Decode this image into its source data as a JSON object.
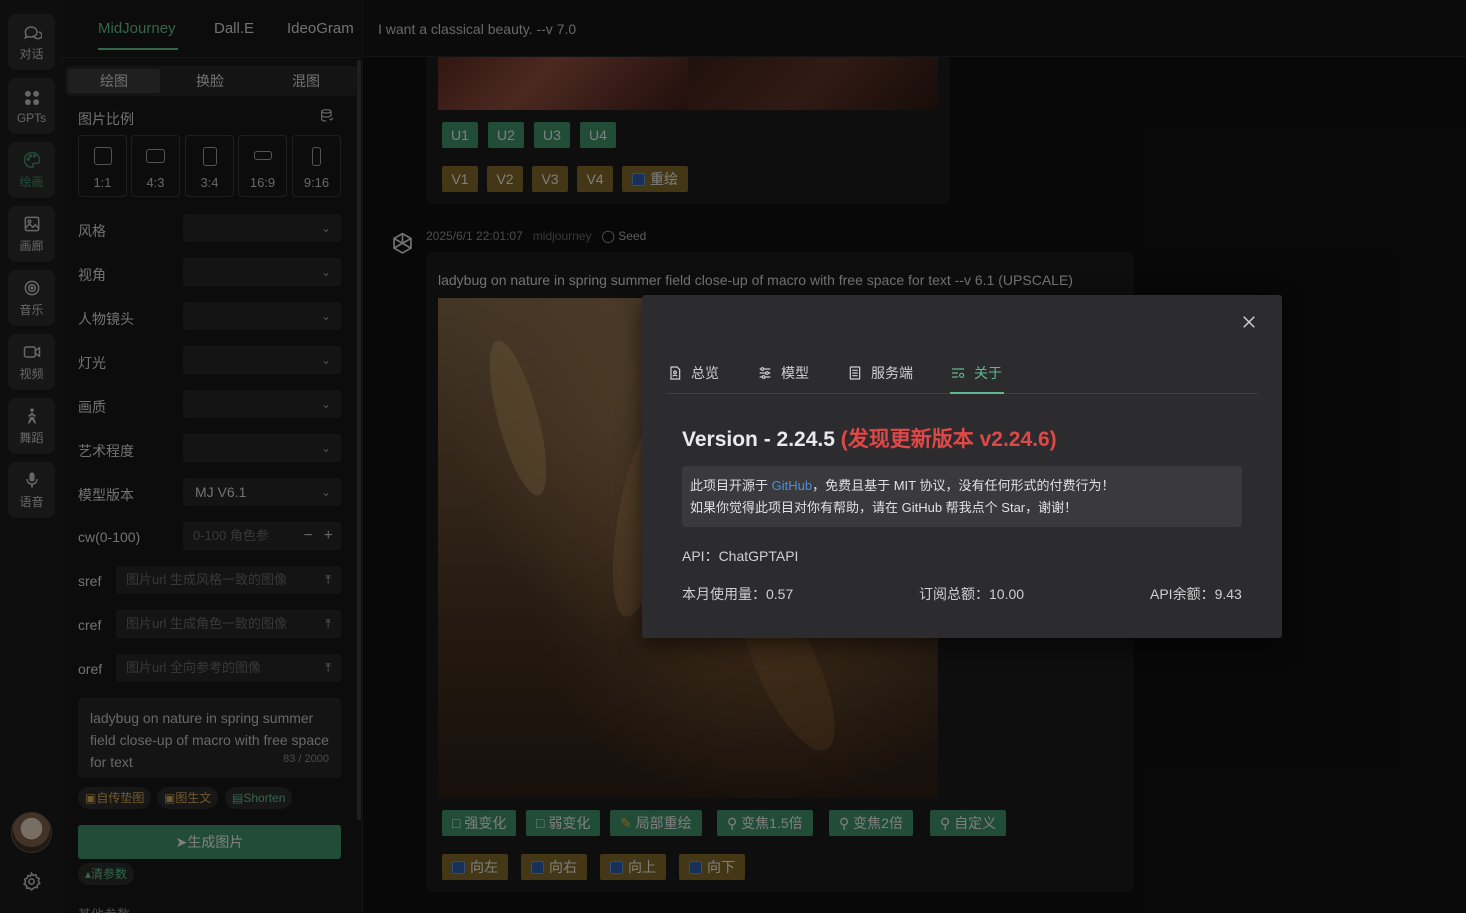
{
  "rail": {
    "items": [
      {
        "label": "对话",
        "icon": "chat-icon"
      },
      {
        "label": "GPTs",
        "icon": "grid-icon"
      },
      {
        "label": "绘画",
        "icon": "palette-icon"
      },
      {
        "label": "画廊",
        "icon": "image-icon"
      },
      {
        "label": "音乐",
        "icon": "music-icon"
      },
      {
        "label": "视频",
        "icon": "video-icon"
      },
      {
        "label": "舞蹈",
        "icon": "dance-icon"
      },
      {
        "label": "语音",
        "icon": "mic-icon"
      }
    ],
    "active": "绘画"
  },
  "panel": {
    "tabs": [
      "MidJourney",
      "Dall.E",
      "IdeoGram"
    ],
    "active_tab": "MidJourney",
    "modes": [
      "绘图",
      "换脸",
      "混图"
    ],
    "active_mode": "绘图",
    "ratio_label": "图片比例",
    "ratios": [
      "1:1",
      "4:3",
      "3:4",
      "16:9",
      "9:16"
    ],
    "fields": {
      "style": "风格",
      "view": "视角",
      "shot": "人物镜头",
      "light": "灯光",
      "quality": "画质",
      "art": "艺术程度",
      "model": "模型版本",
      "model_value": "MJ V6.1",
      "cw": "cw(0-100)",
      "cw_placeholder": "0-100 角色参",
      "sref": "sref",
      "sref_placeholder": "图片url 生成风格一致的图像",
      "cref": "cref",
      "cref_placeholder": "图片url 生成角色一致的图像",
      "oref": "oref",
      "oref_placeholder": "图片url 全向参考的图像"
    },
    "prompt": "ladybug on nature in spring summer field close-up of macro with free space for text",
    "prompt_count": "83 / 2000",
    "chips": [
      "自传垫图",
      "图生文",
      "Shorten"
    ],
    "generate": "生成图片",
    "clear": "清参数",
    "more": "其他参数"
  },
  "main": {
    "header_title": "I want a classical beauty. --v 7.0",
    "u_buttons": [
      "U1",
      "U2",
      "U3",
      "U4"
    ],
    "v_buttons": [
      "V1",
      "V2",
      "V3",
      "V4"
    ],
    "redraw": "重绘",
    "meta_time": "2025/6/1 22:01:07",
    "meta_model": "midjourney",
    "meta_seed": "Seed",
    "message": "ladybug on nature in spring summer field close-up of macro with free space for text --v 6.1 (UPSCALE)",
    "action_buttons": [
      "强变化",
      "弱变化",
      "局部重绘",
      "变焦1.5倍",
      "变焦2倍",
      "自定义"
    ],
    "pan_buttons": [
      "向左",
      "向右",
      "向上",
      "向下"
    ]
  },
  "modal": {
    "tabs": [
      "总览",
      "模型",
      "服务端",
      "关于"
    ],
    "active_tab": "关于",
    "version": "Version - 2.24.5",
    "update": "(发现更新版本 v2.24.6)",
    "info_line1_pre": "此项目开源于",
    "info_link": "GitHub",
    "info_line1_post": "，免费且基于 MIT 协议，没有任何形式的付费行为！",
    "info_line2": "如果你觉得此项目对你有帮助，请在 GitHub 帮我点个 Star，谢谢！",
    "api": "API：ChatGPTAPI",
    "usage": "本月使用量：0.57",
    "subscription": "订阅总额：10.00",
    "balance": "API余额：9.43"
  },
  "colors": {
    "accent": "#5fb98f",
    "green_button": "#3c8a67",
    "gold_button": "#7a6428",
    "update_red": "#e04848",
    "link_blue": "#4a8fe0"
  }
}
